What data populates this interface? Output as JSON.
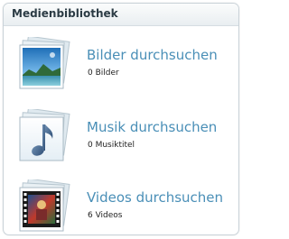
{
  "panel": {
    "title": "Medienbibliothek"
  },
  "items": [
    {
      "title": "Bilder durchsuchen",
      "subtitle": "0 Bilder",
      "icon": "picture-stack-icon"
    },
    {
      "title": "Musik durchsuchen",
      "subtitle": "0 Musiktitel",
      "icon": "music-note-icon"
    },
    {
      "title": "Videos durchsuchen",
      "subtitle": "6 Videos",
      "icon": "film-strip-icon"
    }
  ],
  "colors": {
    "link": "#4a8fb7",
    "border": "#c9d2d8",
    "header_bg": "#e9eef1"
  }
}
